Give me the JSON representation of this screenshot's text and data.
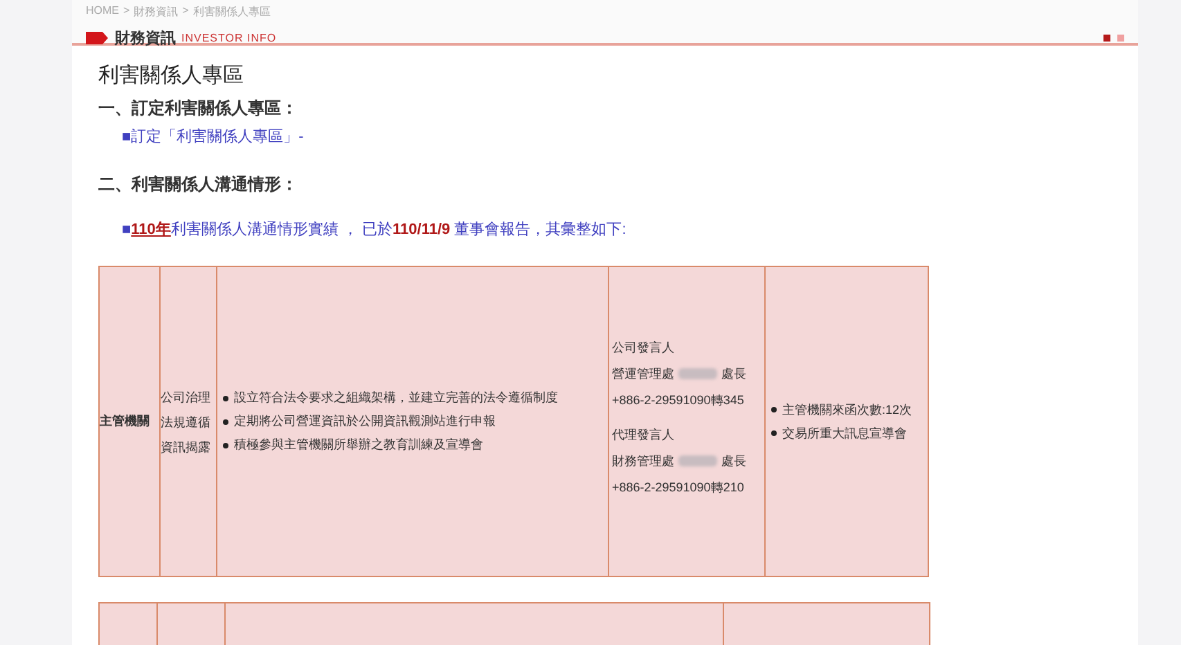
{
  "breadcrumb": [
    "HOME",
    ">",
    "財務資訊",
    ">",
    "利害關係人專區"
  ],
  "section_header": {
    "title": "財務資訊",
    "subtitle": "INVESTOR INFO"
  },
  "page_title": "利害關係人專區",
  "sections": [
    {
      "heading": "一、訂定利害關係人專區：",
      "item": "■訂定「利害關係人專區」-"
    },
    {
      "heading": "二、利害關係人溝通情形：",
      "item": "■**110年**利害關係人溝通情形實績 ， 已於**110/11/9** 董事會報告，其彙整如下:"
    }
  ],
  "table": {
    "rows": [
      {
        "stakeholder": "主管機關",
        "concerns": [
          "公司治理",
          "法規遵循",
          "資訊揭露"
        ],
        "responses": [
          "設立符合法令要求之組織架構，並建立完善的法令遵循制度",
          "定期將公司營運資訊於公開資訊觀測站進行申報",
          "積極參與主管機關所舉辦之教育訓練及宣導會"
        ],
        "contacts": [
          {
            "role": "公司發言人",
            "dept": "營運管理處",
            "title": "處長",
            "phone": "+886-2-29591090轉345"
          },
          {
            "role": "代理發言人",
            "dept": "財務管理處",
            "title": "處長",
            "phone": "+886-2-29591090轉210"
          }
        ],
        "results": [
          "主管機關來函次數:12次",
          "交易所重大訊息宣導會"
        ]
      }
    ]
  }
}
